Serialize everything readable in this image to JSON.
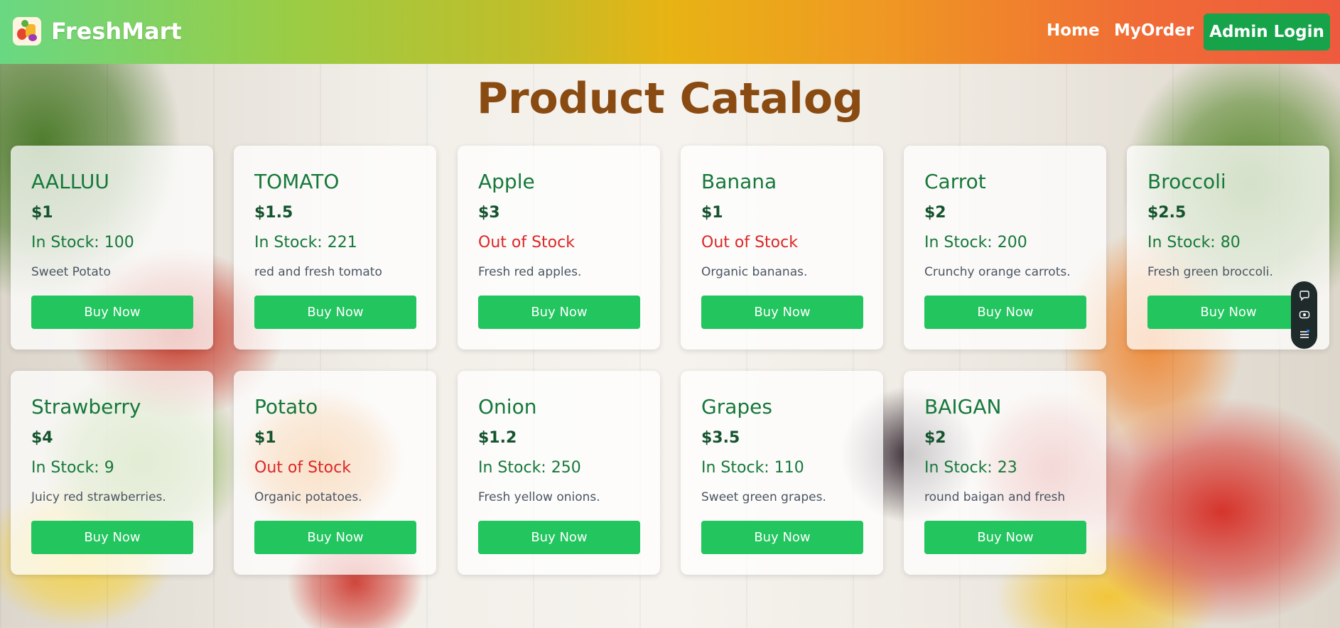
{
  "navbar": {
    "brand_name": "FreshMart",
    "links": {
      "home": "Home",
      "my_order": "MyOrder"
    },
    "admin_button": "Admin Login"
  },
  "page": {
    "title": "Product Catalog"
  },
  "products": [
    {
      "name": "AALLUU",
      "price": "$1",
      "stock": "In Stock: 100",
      "stock_status": "in",
      "description": "Sweet Potato",
      "button": "Buy Now"
    },
    {
      "name": "TOMATO",
      "price": "$1.5",
      "stock": "In Stock: 221",
      "stock_status": "in",
      "description": "red and fresh tomato",
      "button": "Buy Now"
    },
    {
      "name": "Apple",
      "price": "$3",
      "stock": "Out of Stock",
      "stock_status": "out",
      "description": "Fresh red apples.",
      "button": "Buy Now"
    },
    {
      "name": "Banana",
      "price": "$1",
      "stock": "Out of Stock",
      "stock_status": "out",
      "description": "Organic bananas.",
      "button": "Buy Now"
    },
    {
      "name": "Carrot",
      "price": "$2",
      "stock": "In Stock: 200",
      "stock_status": "in",
      "description": "Crunchy orange carrots.",
      "button": "Buy Now"
    },
    {
      "name": "Broccoli",
      "price": "$2.5",
      "stock": "In Stock: 80",
      "stock_status": "in",
      "description": "Fresh green broccoli.",
      "button": "Buy Now"
    },
    {
      "name": "Strawberry",
      "price": "$4",
      "stock": "In Stock: 9",
      "stock_status": "in",
      "description": "Juicy red strawberries.",
      "button": "Buy Now"
    },
    {
      "name": "Potato",
      "price": "$1",
      "stock": "Out of Stock",
      "stock_status": "out",
      "description": "Organic potatoes.",
      "button": "Buy Now"
    },
    {
      "name": "Onion",
      "price": "$1.2",
      "stock": "In Stock: 250",
      "stock_status": "in",
      "description": "Fresh yellow onions.",
      "button": "Buy Now"
    },
    {
      "name": "Grapes",
      "price": "$3.5",
      "stock": "In Stock: 110",
      "stock_status": "in",
      "description": "Sweet green grapes.",
      "button": "Buy Now"
    },
    {
      "name": "BAIGAN",
      "price": "$2",
      "stock": "In Stock: 23",
      "stock_status": "in",
      "description": "round baigan and fresh",
      "button": "Buy Now"
    }
  ],
  "side_toolbar": {
    "icons": [
      "chat-icon",
      "eye-icon",
      "list-icon"
    ]
  },
  "colors": {
    "accent_green": "#22c55e",
    "admin_button": "#16a34a",
    "title_brown": "#8a4b12",
    "product_name_green": "#16783a",
    "out_of_stock_red": "#dc2626"
  }
}
